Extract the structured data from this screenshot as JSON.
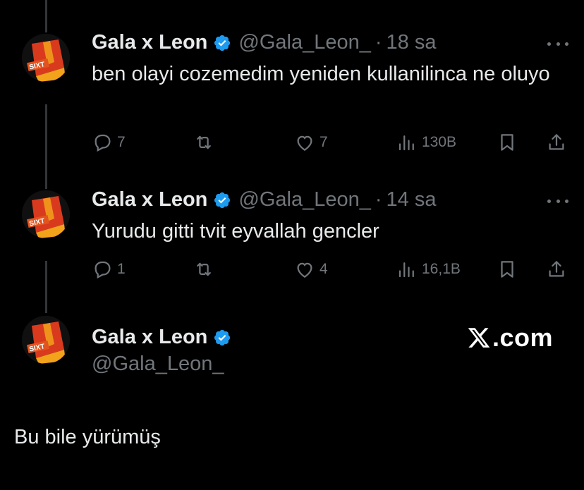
{
  "tweets": [
    {
      "name": "Gala x Leon",
      "handle": "@Gala_Leon_",
      "separator": "·",
      "time": "18 sa",
      "text": "ben olayi cozemedim yeniden kullanilinca ne oluyo",
      "replies": "7",
      "retweets": "",
      "likes": "7",
      "views": "130B"
    },
    {
      "name": "Gala x Leon",
      "handle": "@Gala_Leon_",
      "separator": "·",
      "time": "14 sa",
      "text": "Yurudu gitti tvit eyvallah gencler",
      "replies": "1",
      "retweets": "",
      "likes": "4",
      "views": "16,1B"
    }
  ],
  "profile": {
    "name": "Gala x Leon",
    "handle": "@Gala_Leon_"
  },
  "watermark": {
    "icon": "x-logo-icon",
    "text": ".com"
  },
  "caption": "Bu bile yürümüş",
  "colors": {
    "background": "#000000",
    "text": "#e7e9ea",
    "muted": "#71767b",
    "verified": "#1d9bf0",
    "thread_line": "#333639"
  }
}
